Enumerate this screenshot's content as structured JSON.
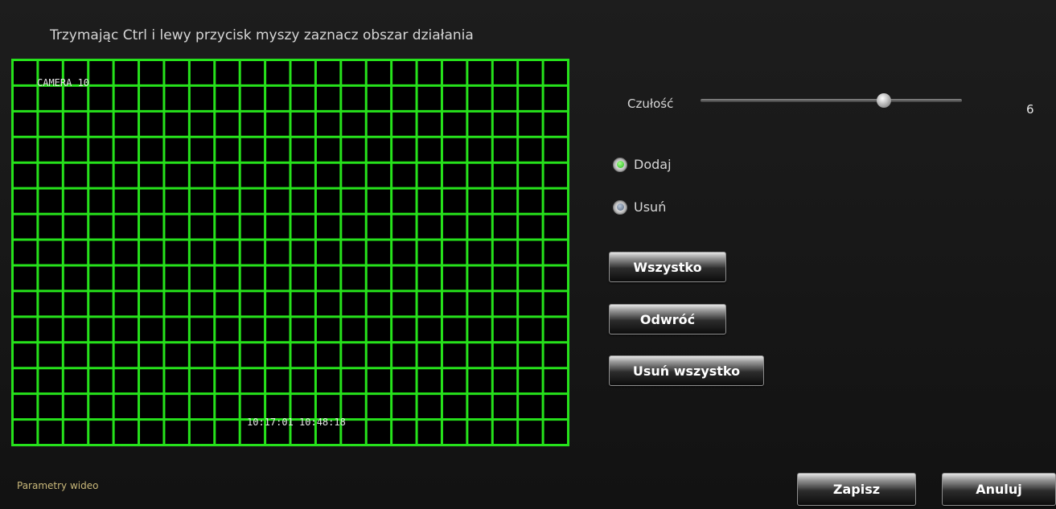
{
  "instruction": "Trzymając Ctrl i lewy przycisk myszy zaznacz obszar działania",
  "grid": {
    "columns": 22,
    "rows": 15,
    "line_color": "#26e21b",
    "background": "#000000",
    "overlay_top": "CAMERA 10",
    "overlay_bottom": "10:17:01 10:48:18"
  },
  "sensitivity": {
    "label": "Czułość",
    "value": "6",
    "level_fraction": 0.7
  },
  "mode": {
    "add_label": "Dodaj",
    "remove_label": "Usuń",
    "selected": "add"
  },
  "buttons": {
    "select_all": "Wszystko",
    "invert": "Odwróć",
    "clear_all": "Usuń wszystko",
    "save": "Zapisz",
    "cancel": "Anuluj"
  },
  "footer": {
    "section_label": "Parametry wideo"
  },
  "colors": {
    "accent_green": "#26e21b",
    "footer_text": "#c8b779"
  }
}
